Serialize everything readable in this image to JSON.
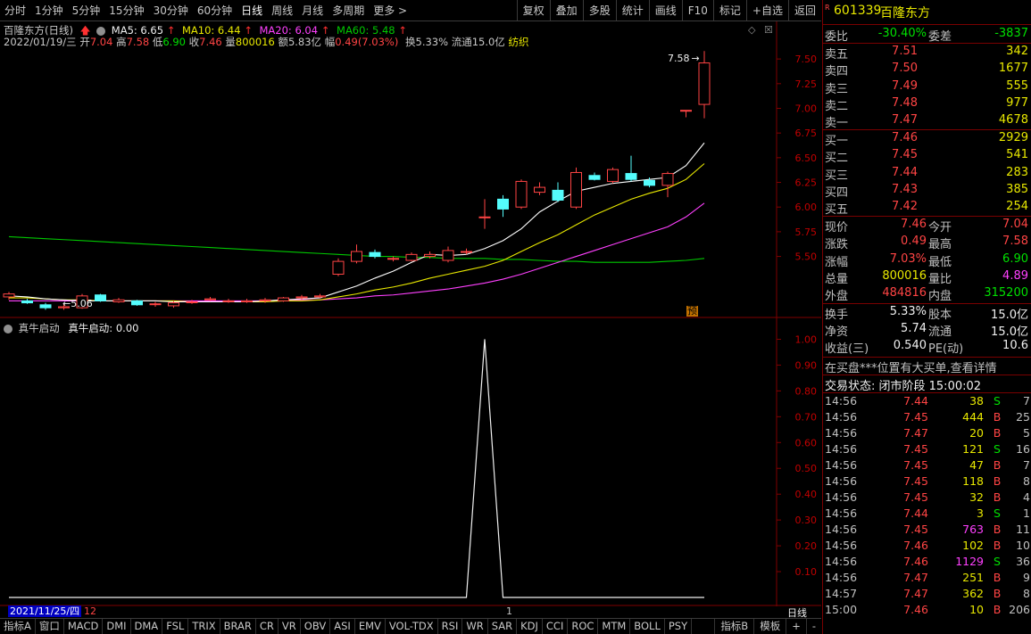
{
  "toolbar": {
    "periods": [
      "分时",
      "1分钟",
      "5分钟",
      "15分钟",
      "30分钟",
      "60分钟",
      "日线",
      "周线",
      "月线",
      "多周期",
      "更多 >"
    ],
    "active_period": "日线",
    "right_buttons": [
      "复权",
      "叠加",
      "多股",
      "统计",
      "画线",
      "F10",
      "标记",
      "+自选",
      "返回"
    ]
  },
  "info": {
    "stock_title": "百隆东方(日线)",
    "ma5": "MA5: 6.65",
    "ma10": "MA10: 6.44",
    "ma20": "MA20: 6.04",
    "ma60": "MA60: 5.48",
    "date": "2022/01/19/三",
    "open_label": "开",
    "open": "7.04",
    "high_label": "高",
    "high": "7.58",
    "low_label": "低",
    "low": "6.90",
    "close_label": "收",
    "close": "7.46",
    "vol_label": "量",
    "vol": "800016",
    "amt": "额5.83亿",
    "chg_label": "幅",
    "chg": "0.49(7.03%)",
    "turnover": "换5.33%",
    "float": "流通15.0亿",
    "industry": "纺织",
    "max_label": "7.58",
    "min_label": "5.06",
    "yu_badge": "预"
  },
  "indicator": {
    "title": "真牛启动",
    "value_label": "真牛启动: 0.00"
  },
  "colors": {
    "up": "#ff4444",
    "down": "#54fcfc",
    "ma5": "#ffffff",
    "ma10": "#e8e800",
    "ma20": "#ff40ff",
    "ma60": "#00c800"
  },
  "chart_data": [
    {
      "type": "candlestick",
      "title": "百隆东方(日线)",
      "ylim": [
        4.9,
        7.7
      ],
      "y_ticks": [
        "7.50",
        "7.25",
        "7.00",
        "6.75",
        "6.50",
        "6.25",
        "6.00",
        "5.75",
        "5.50"
      ],
      "candles": [
        {
          "o": 5.09,
          "c": 5.12,
          "h": 5.14,
          "l": 5.06
        },
        {
          "o": 5.05,
          "c": 5.03,
          "h": 5.07,
          "l": 5.02
        },
        {
          "o": 5.01,
          "c": 4.98,
          "h": 5.03,
          "l": 4.96
        },
        {
          "o": 4.98,
          "c": 4.99,
          "h": 5.02,
          "l": 4.96
        },
        {
          "o": 4.98,
          "c": 5.1,
          "h": 5.12,
          "l": 4.97
        },
        {
          "o": 5.11,
          "c": 5.05,
          "h": 5.12,
          "l": 5.04
        },
        {
          "o": 5.04,
          "c": 5.06,
          "h": 5.08,
          "l": 5.03
        },
        {
          "o": 5.05,
          "c": 5.01,
          "h": 5.06,
          "l": 5.0
        },
        {
          "o": 5.02,
          "c": 5.02,
          "h": 5.04,
          "l": 4.99
        },
        {
          "o": 5.0,
          "c": 5.03,
          "h": 5.05,
          "l": 4.98
        },
        {
          "o": 5.04,
          "c": 5.04,
          "h": 5.06,
          "l": 5.02
        },
        {
          "o": 5.06,
          "c": 5.07,
          "h": 5.09,
          "l": 5.05
        },
        {
          "o": 5.05,
          "c": 5.05,
          "h": 5.07,
          "l": 5.03
        },
        {
          "o": 5.04,
          "c": 5.05,
          "h": 5.07,
          "l": 5.03
        },
        {
          "o": 5.05,
          "c": 5.06,
          "h": 5.08,
          "l": 5.03
        },
        {
          "o": 5.05,
          "c": 5.08,
          "h": 5.09,
          "l": 5.04
        },
        {
          "o": 5.08,
          "c": 5.09,
          "h": 5.11,
          "l": 5.06
        },
        {
          "o": 5.09,
          "c": 5.1,
          "h": 5.12,
          "l": 5.08
        },
        {
          "o": 5.32,
          "c": 5.45,
          "h": 5.48,
          "l": 5.3
        },
        {
          "o": 5.45,
          "c": 5.55,
          "h": 5.62,
          "l": 5.43
        },
        {
          "o": 5.54,
          "c": 5.5,
          "h": 5.57,
          "l": 5.48
        },
        {
          "o": 5.48,
          "c": 5.48,
          "h": 5.5,
          "l": 5.45
        },
        {
          "o": 5.46,
          "c": 5.52,
          "h": 5.54,
          "l": 5.45
        },
        {
          "o": 5.5,
          "c": 5.52,
          "h": 5.55,
          "l": 5.48
        },
        {
          "o": 5.46,
          "c": 5.56,
          "h": 5.6,
          "l": 5.44
        },
        {
          "o": 5.55,
          "c": 5.55,
          "h": 5.58,
          "l": 5.52
        },
        {
          "o": 5.9,
          "c": 5.9,
          "h": 6.08,
          "l": 5.78
        },
        {
          "o": 6.08,
          "c": 5.98,
          "h": 6.12,
          "l": 5.9
        },
        {
          "o": 6.0,
          "c": 6.26,
          "h": 6.28,
          "l": 5.98
        },
        {
          "o": 6.15,
          "c": 6.2,
          "h": 6.25,
          "l": 6.12
        },
        {
          "o": 6.17,
          "c": 6.07,
          "h": 6.25,
          "l": 6.05
        },
        {
          "o": 6.0,
          "c": 6.35,
          "h": 6.4,
          "l": 5.98
        },
        {
          "o": 6.32,
          "c": 6.28,
          "h": 6.35,
          "l": 6.27
        },
        {
          "o": 6.26,
          "c": 6.38,
          "h": 6.4,
          "l": 6.24
        },
        {
          "o": 6.34,
          "c": 6.28,
          "h": 6.52,
          "l": 6.26
        },
        {
          "o": 6.27,
          "c": 6.22,
          "h": 6.3,
          "l": 6.2
        },
        {
          "o": 6.22,
          "c": 6.34,
          "h": 6.36,
          "l": 6.1
        },
        {
          "o": 6.98,
          "c": 6.98,
          "h": 6.98,
          "l": 6.91
        },
        {
          "o": 7.04,
          "c": 7.46,
          "h": 7.58,
          "l": 6.9
        }
      ],
      "ma5": [
        5.1,
        5.09,
        5.07,
        5.06,
        5.05,
        5.05,
        5.05,
        5.05,
        5.05,
        5.04,
        5.04,
        5.04,
        5.04,
        5.04,
        5.05,
        5.06,
        5.07,
        5.08,
        5.14,
        5.2,
        5.28,
        5.35,
        5.44,
        5.52,
        5.51,
        5.52,
        5.58,
        5.66,
        5.78,
        5.95,
        6.06,
        6.16,
        6.2,
        6.24,
        6.26,
        6.28,
        6.3,
        6.42,
        6.65
      ],
      "ma10": [
        5.08,
        5.08,
        5.07,
        5.06,
        5.06,
        5.05,
        5.05,
        5.05,
        5.05,
        5.05,
        5.04,
        5.04,
        5.04,
        5.04,
        5.04,
        5.05,
        5.05,
        5.06,
        5.09,
        5.12,
        5.16,
        5.19,
        5.23,
        5.28,
        5.32,
        5.36,
        5.4,
        5.46,
        5.55,
        5.64,
        5.72,
        5.82,
        5.92,
        6.0,
        6.08,
        6.14,
        6.19,
        6.28,
        6.44
      ],
      "ma20": [
        5.05,
        5.05,
        5.05,
        5.05,
        5.05,
        5.05,
        5.05,
        5.05,
        5.05,
        5.05,
        5.05,
        5.05,
        5.05,
        5.05,
        5.05,
        5.06,
        5.06,
        5.06,
        5.07,
        5.08,
        5.1,
        5.11,
        5.13,
        5.15,
        5.17,
        5.2,
        5.23,
        5.27,
        5.32,
        5.38,
        5.44,
        5.5,
        5.56,
        5.62,
        5.68,
        5.74,
        5.8,
        5.9,
        6.04
      ],
      "ma60": [
        5.7,
        5.69,
        5.68,
        5.67,
        5.66,
        5.65,
        5.64,
        5.63,
        5.62,
        5.61,
        5.6,
        5.59,
        5.58,
        5.57,
        5.56,
        5.55,
        5.54,
        5.53,
        5.52,
        5.51,
        5.5,
        5.5,
        5.49,
        5.49,
        5.48,
        5.48,
        5.48,
        5.47,
        5.47,
        5.46,
        5.45,
        5.45,
        5.44,
        5.44,
        5.44,
        5.44,
        5.45,
        5.46,
        5.48
      ]
    },
    {
      "type": "line",
      "title": "真牛启动",
      "ylim": [
        0,
        1.05
      ],
      "y_ticks": [
        "1.00",
        "0.90",
        "0.80",
        "0.70",
        "0.60",
        "0.50",
        "0.40",
        "0.30",
        "0.20",
        "0.10"
      ],
      "series": [
        {
          "name": "真牛启动",
          "values": [
            0,
            0,
            0,
            0,
            0,
            0,
            0,
            0,
            0,
            0,
            0,
            0,
            0,
            0,
            0,
            0,
            0,
            0,
            0,
            0,
            0,
            0,
            0,
            0,
            0,
            0,
            1,
            0,
            0,
            0,
            0,
            0,
            0,
            0,
            0,
            0,
            0,
            0,
            0
          ]
        }
      ]
    }
  ],
  "date_axis": {
    "start": "2021/11/25/四",
    "labels": [
      "12",
      "1"
    ]
  },
  "bottom_tabs": [
    "指标A",
    "窗口",
    "MACD",
    "DMI",
    "DMA",
    "FSL",
    "TRIX",
    "BRAR",
    "CR",
    "VR",
    "OBV",
    "ASI",
    "EMV",
    "VOL-TDX",
    "RSI",
    "WR",
    "SAR",
    "KDJ",
    "CCI",
    "ROC",
    "MTM",
    "BOLL",
    "PSY"
  ],
  "bottom_right": [
    "指标B",
    "模板",
    "+",
    "-"
  ],
  "period_label": "日线",
  "panel": {
    "r_mark": "R",
    "code": "601339",
    "name": "百隆东方",
    "weibi_label": "委比",
    "weibi": "-30.40%",
    "weicha_label": "委差",
    "weicha": "-3837",
    "asks": [
      {
        "label": "卖五",
        "price": "7.51",
        "vol": "342"
      },
      {
        "label": "卖四",
        "price": "7.50",
        "vol": "1677"
      },
      {
        "label": "卖三",
        "price": "7.49",
        "vol": "555"
      },
      {
        "label": "卖二",
        "price": "7.48",
        "vol": "977"
      },
      {
        "label": "卖一",
        "price": "7.47",
        "vol": "4678"
      }
    ],
    "bids": [
      {
        "label": "买一",
        "price": "7.46",
        "vol": "2929"
      },
      {
        "label": "买二",
        "price": "7.45",
        "vol": "541"
      },
      {
        "label": "买三",
        "price": "7.44",
        "vol": "283"
      },
      {
        "label": "买四",
        "price": "7.43",
        "vol": "385"
      },
      {
        "label": "买五",
        "price": "7.42",
        "vol": "254"
      }
    ],
    "quote": [
      {
        "l1": "现价",
        "v1": "7.46",
        "l2": "今开",
        "v2": "7.04"
      },
      {
        "l1": "涨跌",
        "v1": "0.49",
        "l2": "最高",
        "v2": "7.58"
      },
      {
        "l1": "涨幅",
        "v1": "7.03%",
        "l2": "最低",
        "v2": "6.90"
      },
      {
        "l1": "总量",
        "v1": "800016",
        "l2": "量比",
        "v2": "4.89"
      },
      {
        "l1": "外盘",
        "v1": "484816",
        "l2": "内盘",
        "v2": "315200"
      }
    ],
    "fund": [
      {
        "l1": "换手",
        "v1": "5.33%",
        "l2": "股本",
        "v2": "15.0亿"
      },
      {
        "l1": "净资",
        "v1": "5.74",
        "l2": "流通",
        "v2": "15.0亿"
      },
      {
        "l1": "收益(三)",
        "v1": "0.540",
        "l2": "PE(动)",
        "v2": "10.6"
      }
    ],
    "notice": "在买盘***位置有大买单,查看详情",
    "status": "交易状态: 闭市阶段 15:00:02",
    "ticks": [
      {
        "t": "14:56",
        "p": "7.44",
        "v": "38",
        "s": "S",
        "n": "7"
      },
      {
        "t": "14:56",
        "p": "7.45",
        "v": "444",
        "s": "B",
        "n": "25"
      },
      {
        "t": "14:56",
        "p": "7.47",
        "v": "20",
        "s": "B",
        "n": "5"
      },
      {
        "t": "14:56",
        "p": "7.45",
        "v": "121",
        "s": "S",
        "n": "16"
      },
      {
        "t": "14:56",
        "p": "7.45",
        "v": "47",
        "s": "B",
        "n": "7"
      },
      {
        "t": "14:56",
        "p": "7.45",
        "v": "118",
        "s": "B",
        "n": "8"
      },
      {
        "t": "14:56",
        "p": "7.45",
        "v": "32",
        "s": "B",
        "n": "4"
      },
      {
        "t": "14:56",
        "p": "7.44",
        "v": "3",
        "s": "S",
        "n": "1"
      },
      {
        "t": "14:56",
        "p": "7.45",
        "v": "763",
        "s": "B",
        "n": "11"
      },
      {
        "t": "14:56",
        "p": "7.46",
        "v": "102",
        "s": "B",
        "n": "10"
      },
      {
        "t": "14:56",
        "p": "7.46",
        "v": "1129",
        "s": "S",
        "n": "36"
      },
      {
        "t": "14:56",
        "p": "7.47",
        "v": "251",
        "s": "B",
        "n": "9"
      },
      {
        "t": "14:57",
        "p": "7.47",
        "v": "362",
        "s": "B",
        "n": "8"
      },
      {
        "t": "15:00",
        "p": "7.46",
        "v": "10",
        "s": "B",
        "n": "206"
      }
    ]
  }
}
